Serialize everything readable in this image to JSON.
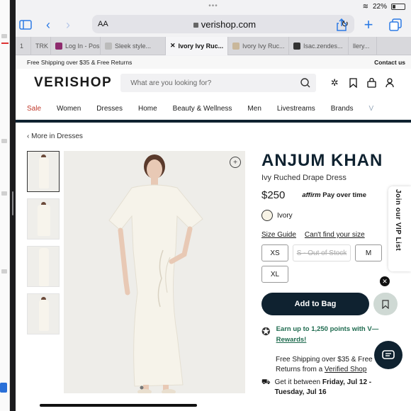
{
  "status": {
    "battery": "22%"
  },
  "browser": {
    "aa_label": "AA",
    "url": "verishop.com",
    "tabs": [
      {
        "label": "1",
        "active": false
      },
      {
        "label": "TRK",
        "active": false
      },
      {
        "label": "Log In - Pos",
        "active": false
      },
      {
        "label": "Sleek style...",
        "active": false
      },
      {
        "label": "Ivory Ivy Ruc...",
        "active": true
      },
      {
        "label": "Ivory Ivy Ruc...",
        "active": false
      },
      {
        "label": "Isac.zendes...",
        "active": false
      },
      {
        "label": "llery...",
        "active": false
      }
    ]
  },
  "promo": {
    "left": "Free Shipping over $35 & Free Returns",
    "right": "Contact us"
  },
  "header": {
    "logo": "VERISHOP",
    "search_placeholder": "What are you looking for?"
  },
  "nav": [
    "Sale",
    "Women",
    "Dresses",
    "Home",
    "Beauty & Wellness",
    "Men",
    "Livestreams",
    "Brands",
    "V"
  ],
  "breadcrumb": "‹ More in Dresses",
  "product": {
    "brand": "ANJUM KHAN",
    "name": "Ivy Ruched Drape Dress",
    "price": "$250",
    "affirm_logo": "affirm",
    "affirm_text": "Pay over time",
    "color": "Ivory",
    "size_guide": "Size Guide",
    "cant_find": "Can't find your size",
    "sizes": [
      {
        "label": "XS",
        "out_of_stock": false
      },
      {
        "label": "S - Out of Stock",
        "out_of_stock": true
      },
      {
        "label": "M",
        "out_of_stock": false
      },
      {
        "label": "XL",
        "out_of_stock": false
      }
    ],
    "add_to_bag": "Add to Bag",
    "points_line1": "Earn up to 1,250 points with V—",
    "points_line2": "Rewards!",
    "ship_line1": "Free Shipping over $35 & Free",
    "ship_line2_prefix": "Returns from a",
    "ship_link": "Verified Shop",
    "delivery_prefix": "Get it between",
    "delivery_dates": "Friday, Jul 12 -",
    "delivery_dates2": "Tuesday, Jul 16"
  },
  "vip": "Join our VIP List"
}
